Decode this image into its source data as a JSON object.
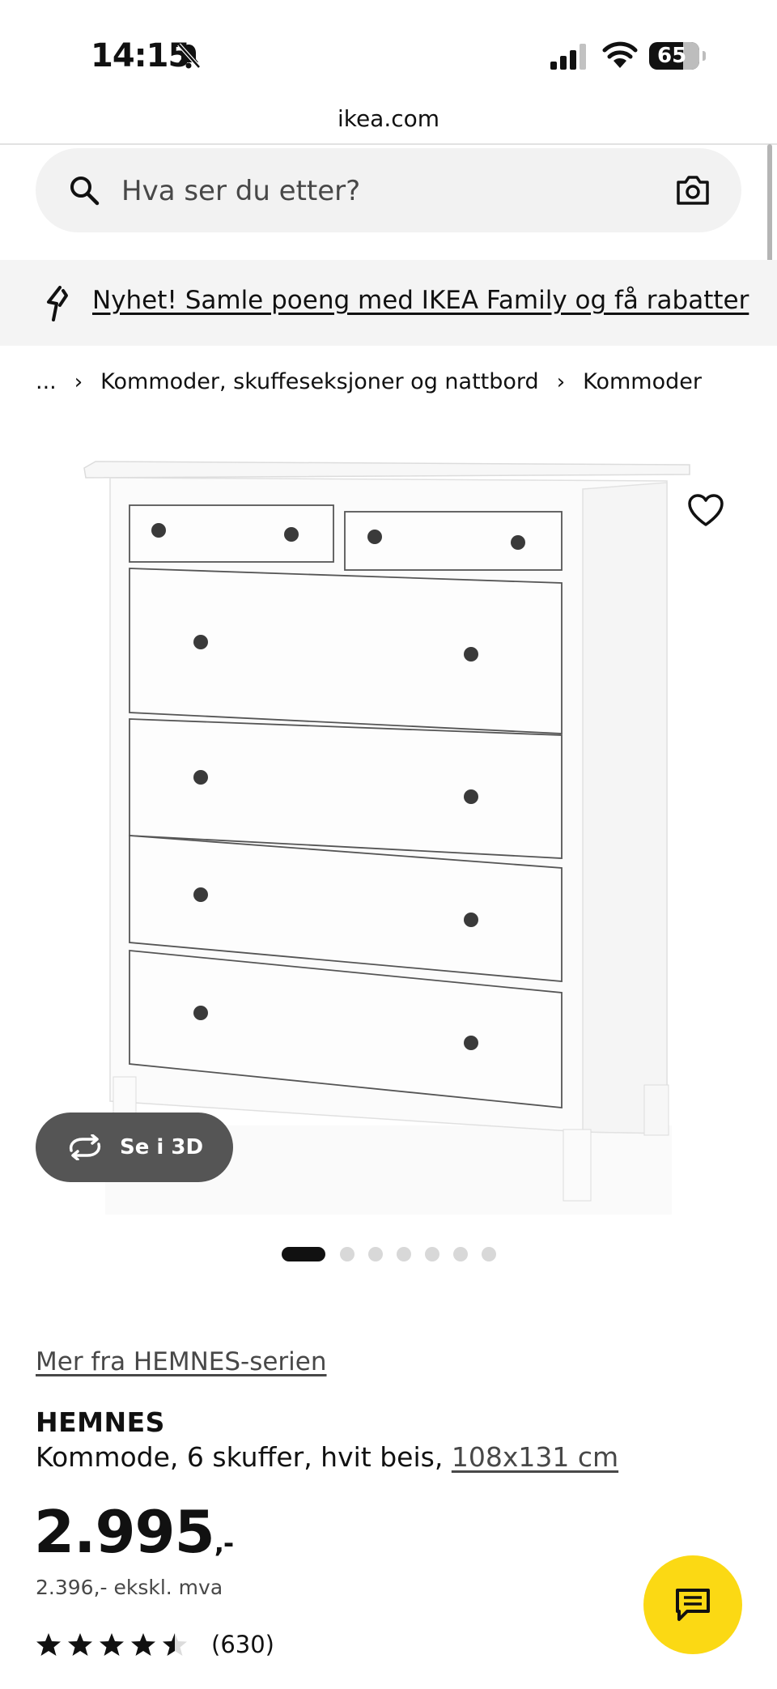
{
  "status_bar": {
    "time": "14:15",
    "battery": "65"
  },
  "browser": {
    "url": "ikea.com"
  },
  "search": {
    "placeholder": "Hva ser du etter?"
  },
  "banner": {
    "text": "Nyhet! Samle poeng med IKEA Family og få rabatter"
  },
  "breadcrumb": {
    "ellipsis": "...",
    "items": [
      "Kommoder, skuffeseksjoner og nattbord",
      "Kommoder"
    ]
  },
  "gallery": {
    "view_3d_label": "Se i 3D",
    "image_count": 7,
    "active_index": 0
  },
  "product": {
    "series_link": "Mer fra HEMNES-serien",
    "name": "HEMNES",
    "description": "Kommode, 6 skuffer, hvit beis,",
    "size": "108x131 cm",
    "price": "2.995",
    "price_suffix": ",-",
    "price_ex_vat": "2.396,- ekskl. mva",
    "rating": 4.5,
    "review_count": "(630)"
  },
  "colors": {
    "chat_button": "#fbd914",
    "text": "#111111"
  }
}
